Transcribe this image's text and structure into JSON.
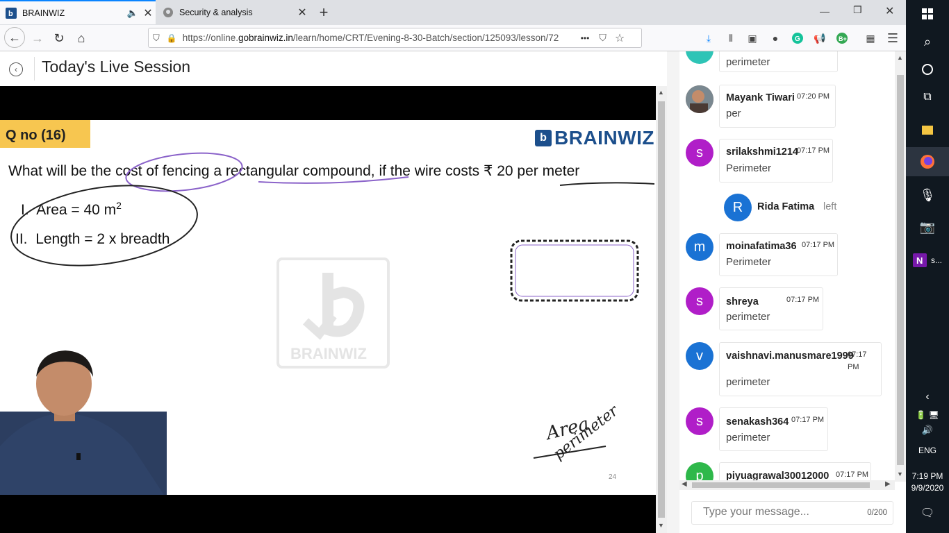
{
  "browser": {
    "tabs": [
      {
        "label": "BRAINWIZ",
        "active": true
      },
      {
        "label": "Security & analysis",
        "active": false
      }
    ],
    "new_tab_label": "+",
    "url_prefix": "https://online.",
    "url_domain": "gobrainwiz.in",
    "url_path": "/learn/home/CRT/Evening-8-30-Batch/section/125093/lesson/72",
    "more_label": "•••"
  },
  "page": {
    "title": "Today's Live Session"
  },
  "slide": {
    "qno": "Q no (16)",
    "brand": "BRAINWIZ",
    "question": "What will be the cost of fencing a rectangular compound, if the wire costs ₹ 20 per meter",
    "statement1_label": "I.",
    "statement1": "Area = 40 m",
    "statement1_sup": "2",
    "statement2_label": "II.",
    "statement2": "Length = 2 x breadth",
    "watermark": "BRAINWIZ",
    "note1": "Area",
    "note2": "perimeter",
    "page_number": "24"
  },
  "chat": {
    "messages": [
      {
        "user": "",
        "time": "",
        "text": "perimeter",
        "initial": "",
        "color": "#2ec4b6"
      },
      {
        "user": "Mayank Tiwari",
        "time": "07:20 PM",
        "text": "per",
        "initial": "",
        "color": "#6b4a3a"
      },
      {
        "user": "srilakshmi1214",
        "time": "07:17 PM",
        "text": "Perimeter",
        "initial": "s",
        "color": "#b01ec8"
      },
      {
        "user": "moinafatima36",
        "time": "07:17 PM",
        "text": "Perimeter",
        "initial": "m",
        "color": "#1a72d4"
      },
      {
        "user": "shreya",
        "time": "07:17 PM",
        "text": "perimeter",
        "initial": "s",
        "color": "#b01ec8"
      },
      {
        "user": "vaishnavi.manusmare1999",
        "time_line1": "07:17",
        "time_line2": "PM",
        "text": "perimeter",
        "initial": "v",
        "color": "#1a72d4"
      },
      {
        "user": "senakash364",
        "time": "07:17 PM",
        "text": "perimeter",
        "initial": "s",
        "color": "#b01ec8"
      },
      {
        "user": "piyuagrawal30012000",
        "time": "07:17 PM",
        "text": "",
        "initial": "p",
        "color": "#2eb84a"
      }
    ],
    "system_event": {
      "user": "Rida Fatima",
      "action": "left",
      "initial": "R",
      "color": "#1a72d4"
    },
    "input_placeholder": "Type your message...",
    "char_count": "0/200"
  },
  "taskbar": {
    "onenote_label": "s...",
    "language": "ENG",
    "time": "7:19 PM",
    "date": "9/9/2020"
  }
}
